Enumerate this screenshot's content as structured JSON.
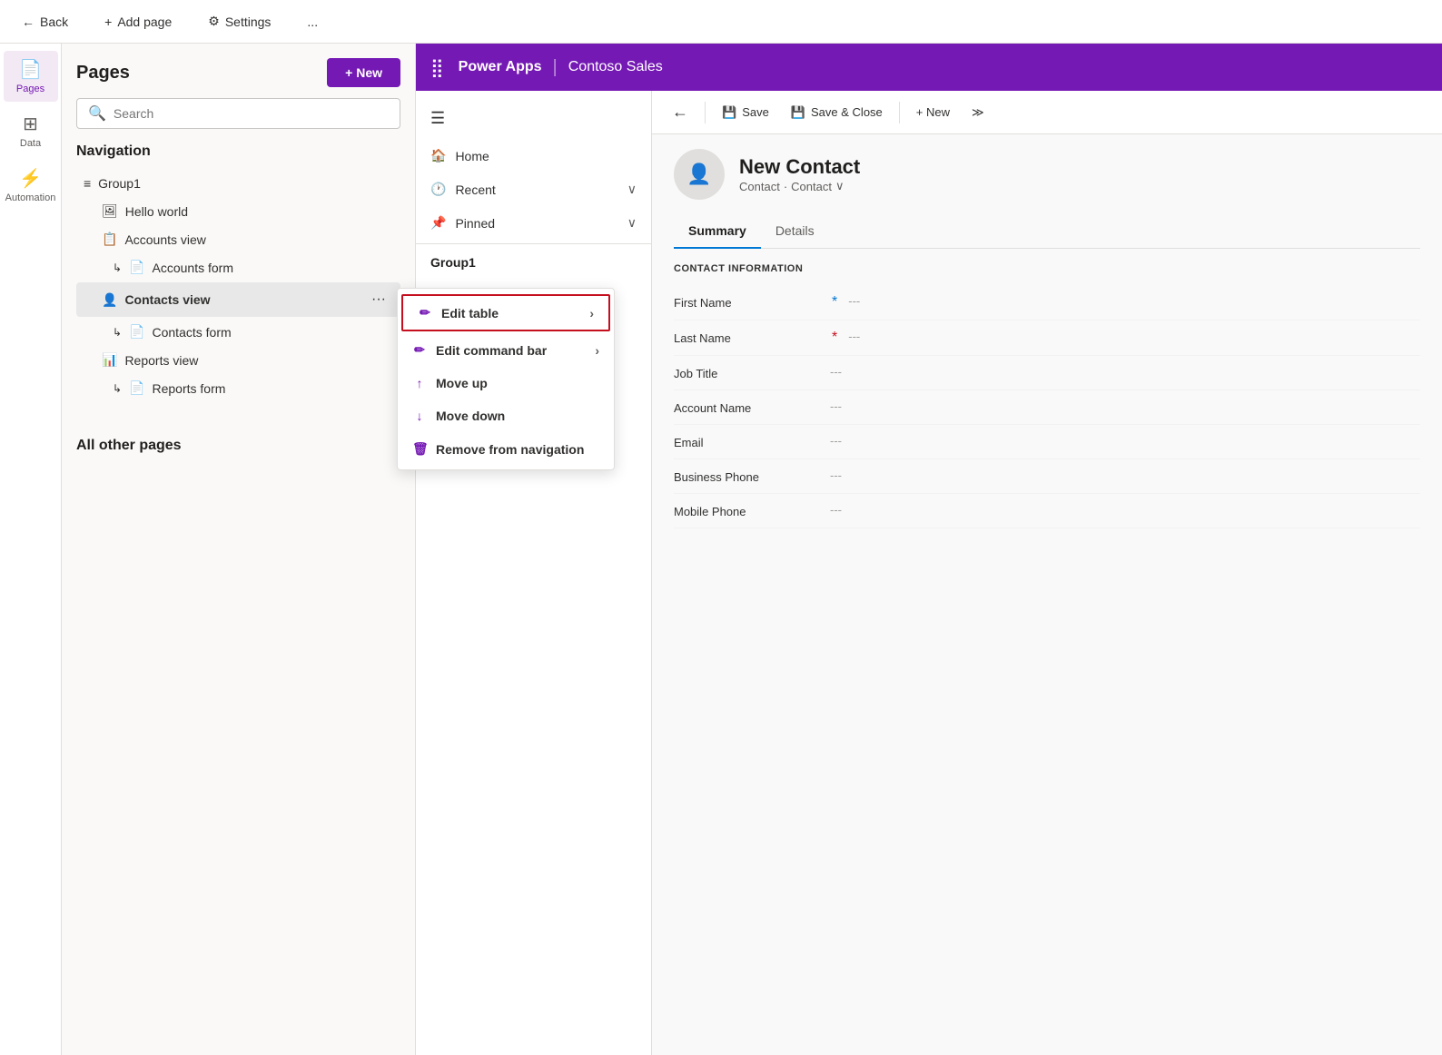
{
  "topBar": {
    "backLabel": "Back",
    "addPageLabel": "Add page",
    "settingsLabel": "Settings",
    "moreLabel": "..."
  },
  "iconSidebar": {
    "items": [
      {
        "id": "pages",
        "label": "Pages",
        "icon": "📄",
        "active": true
      },
      {
        "id": "data",
        "label": "Data",
        "icon": "⊞",
        "active": false
      },
      {
        "id": "automation",
        "label": "Automation",
        "icon": "⚡",
        "active": false
      }
    ]
  },
  "pagesPanel": {
    "title": "Pages",
    "newButtonLabel": "+ New",
    "search": {
      "placeholder": "Search"
    },
    "navigationTitle": "Navigation",
    "navigationItems": [
      {
        "id": "group1",
        "label": "Group1",
        "type": "group",
        "icon": "≡"
      },
      {
        "id": "hello-world",
        "label": "Hello world",
        "type": "child",
        "icon": "🖼"
      },
      {
        "id": "accounts-view",
        "label": "Accounts view",
        "type": "child",
        "icon": "📋"
      },
      {
        "id": "accounts-form",
        "label": "Accounts form",
        "type": "child",
        "icon": "↳📄"
      },
      {
        "id": "contacts-view",
        "label": "Contacts view",
        "type": "child",
        "icon": "👤",
        "active": true
      },
      {
        "id": "contacts-form",
        "label": "Contacts form",
        "type": "child",
        "icon": "↳📄"
      },
      {
        "id": "reports-view",
        "label": "Reports view",
        "type": "child",
        "icon": "📊"
      },
      {
        "id": "reports-form",
        "label": "Reports form",
        "type": "child",
        "icon": "↳📄"
      }
    ],
    "allOtherPagesTitle": "All other pages"
  },
  "appHeader": {
    "gridIcon": "⣿",
    "title": "Power Apps",
    "separator": "|",
    "subtitle": "Contoso Sales"
  },
  "appNav": {
    "items": [
      {
        "id": "home",
        "label": "Home",
        "icon": "🏠"
      },
      {
        "id": "recent",
        "label": "Recent",
        "icon": "🕐",
        "expandable": true
      },
      {
        "id": "pinned",
        "label": "Pinned",
        "icon": "📌",
        "expandable": true
      }
    ],
    "groupLabel": "Group1"
  },
  "contextMenu": {
    "items": [
      {
        "id": "edit-table",
        "label": "Edit table",
        "icon": "✏️",
        "highlighted": true,
        "submenu": true
      },
      {
        "id": "edit-command-bar",
        "label": "Edit command bar",
        "icon": "✏️",
        "submenu": true
      },
      {
        "id": "move-up",
        "label": "Move up",
        "icon": "↑"
      },
      {
        "id": "move-down",
        "label": "Move down",
        "icon": "↓"
      },
      {
        "id": "remove-from-navigation",
        "label": "Remove from navigation",
        "icon": "🗑"
      }
    ]
  },
  "formPanel": {
    "toolbar": {
      "backLabel": "←",
      "saveLabel": "Save",
      "saveCloseLabel": "Save & Close",
      "newLabel": "+ New",
      "moreLabel": "≫"
    },
    "contact": {
      "title": "New Contact",
      "subtitlePart1": "Contact",
      "subtitleDot": "·",
      "subtitlePart2": "Contact",
      "subtitleDropdown": "∨"
    },
    "tabs": [
      {
        "id": "summary",
        "label": "Summary",
        "active": true
      },
      {
        "id": "details",
        "label": "Details"
      }
    ],
    "sectionTitle": "CONTACT INFORMATION",
    "fields": [
      {
        "id": "first-name",
        "label": "First Name",
        "value": "---",
        "required": "blue"
      },
      {
        "id": "last-name",
        "label": "Last Name",
        "value": "---",
        "required": "red"
      },
      {
        "id": "job-title",
        "label": "Job Title",
        "value": "---"
      },
      {
        "id": "account-name",
        "label": "Account Name",
        "value": "---"
      },
      {
        "id": "email",
        "label": "Email",
        "value": "---"
      },
      {
        "id": "business-phone",
        "label": "Business Phone",
        "value": "---"
      },
      {
        "id": "mobile-phone",
        "label": "Mobile Phone",
        "value": "---"
      }
    ]
  }
}
